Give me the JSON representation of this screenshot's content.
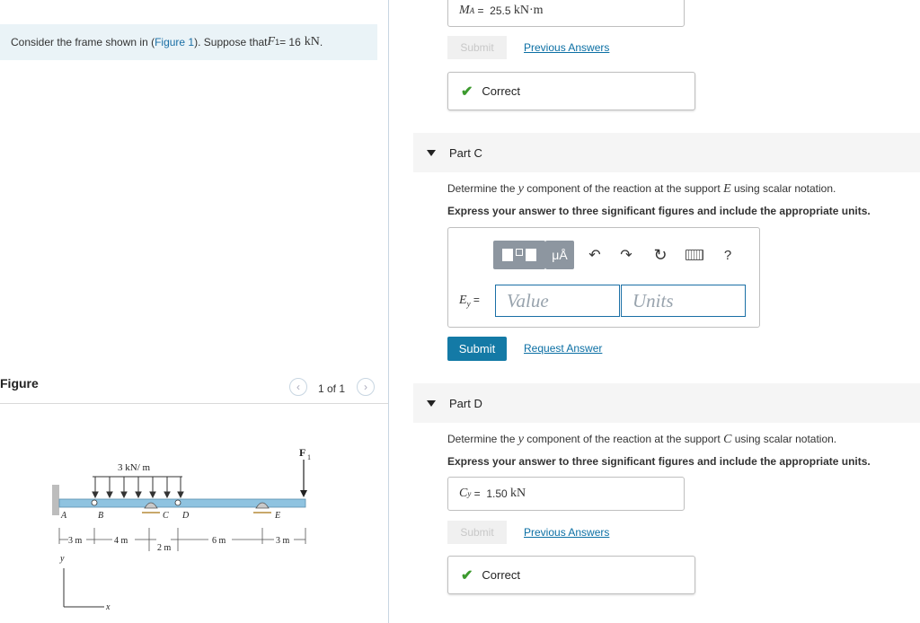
{
  "problem": {
    "text_before": "Consider the frame shown in (",
    "figure_link": "Figure 1",
    "text_after": "). Suppose that ",
    "force_symbol": "F",
    "force_sub": "1",
    "force_eq": " = 16 ",
    "force_unit": "kN",
    "end": "."
  },
  "figure": {
    "label": "Figure",
    "pager": "1 of 1",
    "prev_icon": "chevron-left-icon",
    "next_icon": "chevron-right-icon",
    "load_label": "3 kN/ m",
    "force_label": "F",
    "force_sub": "1",
    "points": [
      "A",
      "B",
      "C",
      "D",
      "E"
    ],
    "dims": [
      "3 m",
      "4 m",
      "2 m",
      "6 m",
      "3 m"
    ],
    "axis_y": "y",
    "axis_x": "x"
  },
  "part_b": {
    "answer_symbol": "M",
    "answer_sub": "A",
    "answer_eq": " =  25.5 ",
    "answer_unit": "kN·m",
    "submit": "Submit",
    "previous_answers": "Previous Answers",
    "status": "Correct"
  },
  "part_c": {
    "title": "Part C",
    "prompt_a": "Determine the ",
    "prompt_var": "y",
    "prompt_b": " component of the reaction at the support ",
    "prompt_support": "E",
    "prompt_c": " using scalar notation.",
    "instruction": "Express your answer to three significant figures and include the appropriate units.",
    "toolbar": {
      "templates_icon": "templates-icon",
      "units_label": "μÅ",
      "undo_icon": "undo-icon",
      "redo_icon": "redo-icon",
      "reset_icon": "reset-icon",
      "keyboard_icon": "keyboard-icon",
      "help_label": "?"
    },
    "input_symbol": "E",
    "input_sub": "y",
    "input_eq": " =",
    "value_placeholder": "Value",
    "units_placeholder": "Units",
    "submit": "Submit",
    "request_answer": "Request Answer"
  },
  "part_d": {
    "title": "Part D",
    "prompt_a": "Determine the ",
    "prompt_var": "y",
    "prompt_b": " component of the reaction at the support ",
    "prompt_support": "C",
    "prompt_c": " using scalar notation.",
    "instruction": "Express your answer to three significant figures and include the appropriate units.",
    "answer_symbol": "C",
    "answer_sub": "y",
    "answer_eq": " =  1.50 ",
    "answer_unit": "kN",
    "submit": "Submit",
    "previous_answers": "Previous Answers",
    "status": "Correct"
  },
  "colors": {
    "accent": "#147aa6",
    "link": "#0b6fa4",
    "correct": "#3c9a2e",
    "problem_bg": "#eaf3f7",
    "beam": "#8fc3e0"
  }
}
